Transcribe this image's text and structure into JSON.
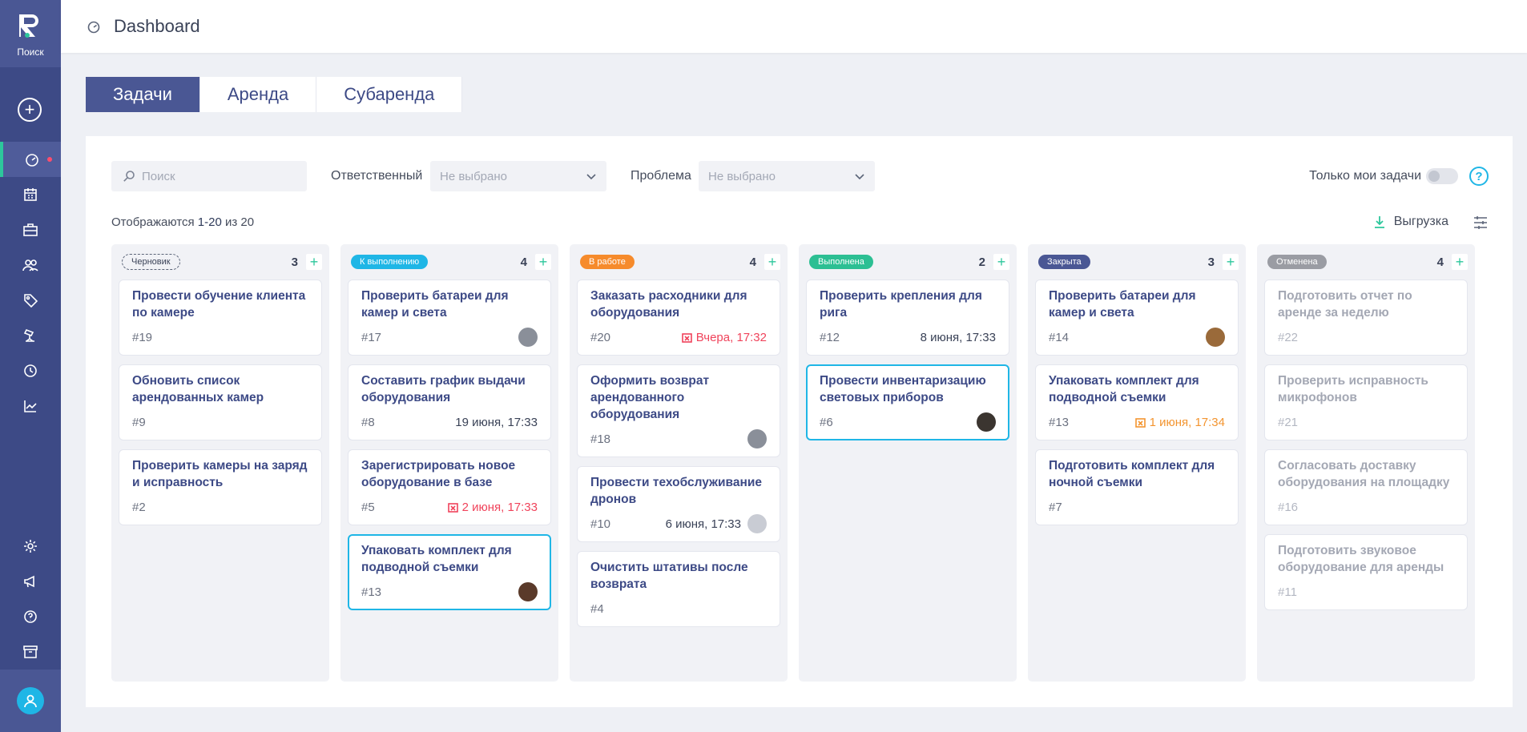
{
  "sidebar": {
    "search_label": "Поиск",
    "items": [
      {
        "icon": "dashboard-icon",
        "active": true
      },
      {
        "icon": "calendar-icon"
      },
      {
        "icon": "briefcase-icon"
      },
      {
        "icon": "users-icon"
      },
      {
        "icon": "tag-icon"
      },
      {
        "icon": "camera-icon"
      },
      {
        "icon": "history-icon"
      },
      {
        "icon": "chart-icon"
      }
    ],
    "bottom_items": [
      {
        "icon": "gear-icon"
      },
      {
        "icon": "megaphone-icon"
      },
      {
        "icon": "help-icon"
      },
      {
        "icon": "archive-icon"
      }
    ]
  },
  "header": {
    "title": "Dashboard"
  },
  "tabs": [
    {
      "label": "Задачи",
      "active": true
    },
    {
      "label": "Аренда"
    },
    {
      "label": "Субаренда"
    }
  ],
  "filters": {
    "search_placeholder": "Поиск",
    "responsible_label": "Ответственный",
    "responsible_value": "Не выбрано",
    "problem_label": "Проблема",
    "problem_value": "Не выбрано",
    "only_mine_label": "Только мои задачи",
    "help_glyph": "?"
  },
  "counter": {
    "prefix": "Отображаются ",
    "range": "1-20",
    "suffix": " из 20"
  },
  "export_label": "Выгрузка",
  "add_glyph": "+",
  "columns": [
    {
      "status": "Черновик",
      "count": "3",
      "color": "draft",
      "cards": [
        {
          "title": "Провести обучение клиента по камере",
          "id": "#19"
        },
        {
          "title": "Обновить список арендованных камер",
          "id": "#9"
        },
        {
          "title": "Проверить камеры на заряд и исправность",
          "id": "#2"
        }
      ]
    },
    {
      "status": "К выполнению",
      "count": "4",
      "color": "#1fb6e6",
      "cards": [
        {
          "title": "Проверить батареи для камер и света",
          "id": "#17",
          "avatar": "#8a8f99"
        },
        {
          "title": "Составить график выдачи оборудования",
          "id": "#8",
          "date": "19 июня, 17:33"
        },
        {
          "title": "Зарегистрировать новое оборудование в базе",
          "id": "#5",
          "date": "2 июня, 17:33",
          "date_state": "overdue"
        },
        {
          "title": "Упаковать комплект для подводной съемки",
          "id": "#13",
          "avatar": "#5a3a2a",
          "highlight": true
        }
      ]
    },
    {
      "status": "В работе",
      "count": "4",
      "color": "#f68b2c",
      "cards": [
        {
          "title": "Заказать расходники для оборудования",
          "id": "#20",
          "date": "Вчера, 17:32",
          "date_state": "overdue"
        },
        {
          "title": "Оформить возврат арендованного оборудования",
          "id": "#18",
          "avatar": "#8a8f99"
        },
        {
          "title": "Провести техобслуживание дронов",
          "id": "#10",
          "date": "6 июня, 17:33",
          "avatar": "#c9ccd4"
        },
        {
          "title": "Очистить штативы после возврата",
          "id": "#4"
        }
      ]
    },
    {
      "status": "Выполнена",
      "count": "2",
      "color": "#2cbf93",
      "cards": [
        {
          "title": "Проверить крепления для рига",
          "id": "#12",
          "date": "8 июня, 17:33"
        },
        {
          "title": "Провести инвентаризацию световых приборов",
          "id": "#6",
          "avatar": "#3b3530",
          "highlight": true
        }
      ]
    },
    {
      "status": "Закрыта",
      "count": "3",
      "color": "#4a5794",
      "cards": [
        {
          "title": "Проверить батареи для камер и света",
          "id": "#14",
          "avatar": "#9a6a3a"
        },
        {
          "title": "Упаковать комплект для подводной съемки",
          "id": "#13",
          "date": "1 июня, 17:34",
          "date_state": "warn"
        },
        {
          "title": "Подготовить комплект для ночной съемки",
          "id": "#7"
        }
      ]
    },
    {
      "status": "Отменена",
      "count": "4",
      "color": "#9a9ca3",
      "cancelled": true,
      "cards": [
        {
          "title": "Подготовить отчет по аренде за неделю",
          "id": "#22"
        },
        {
          "title": "Проверить исправность микрофонов",
          "id": "#21"
        },
        {
          "title": "Согласовать доставку оборудования на площадку",
          "id": "#16"
        },
        {
          "title": "Подготовить звуковое оборудование для аренды",
          "id": "#11"
        }
      ]
    }
  ]
}
